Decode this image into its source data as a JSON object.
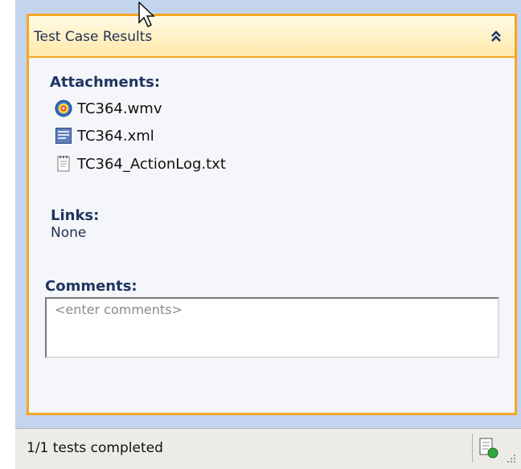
{
  "panel": {
    "title": "Test Case Results",
    "collapse_icon": "double-chevron-up-icon"
  },
  "attachments": {
    "label": "Attachments:",
    "items": [
      {
        "name": "TC364.wmv",
        "icon": "media-file-icon"
      },
      {
        "name": "TC364.xml",
        "icon": "xml-file-icon"
      },
      {
        "name": "TC364_ActionLog.txt",
        "icon": "text-file-icon"
      }
    ]
  },
  "links": {
    "label": "Links:",
    "value": "None"
  },
  "comments": {
    "label": "Comments:",
    "placeholder": "<enter comments>",
    "value": ""
  },
  "statusbar": {
    "text": "1/1 tests completed",
    "icon": "test-status-icon"
  },
  "colors": {
    "panel_border": "#f5a623",
    "window_bg": "#c3d5ee",
    "label_text": "#1f3561"
  }
}
